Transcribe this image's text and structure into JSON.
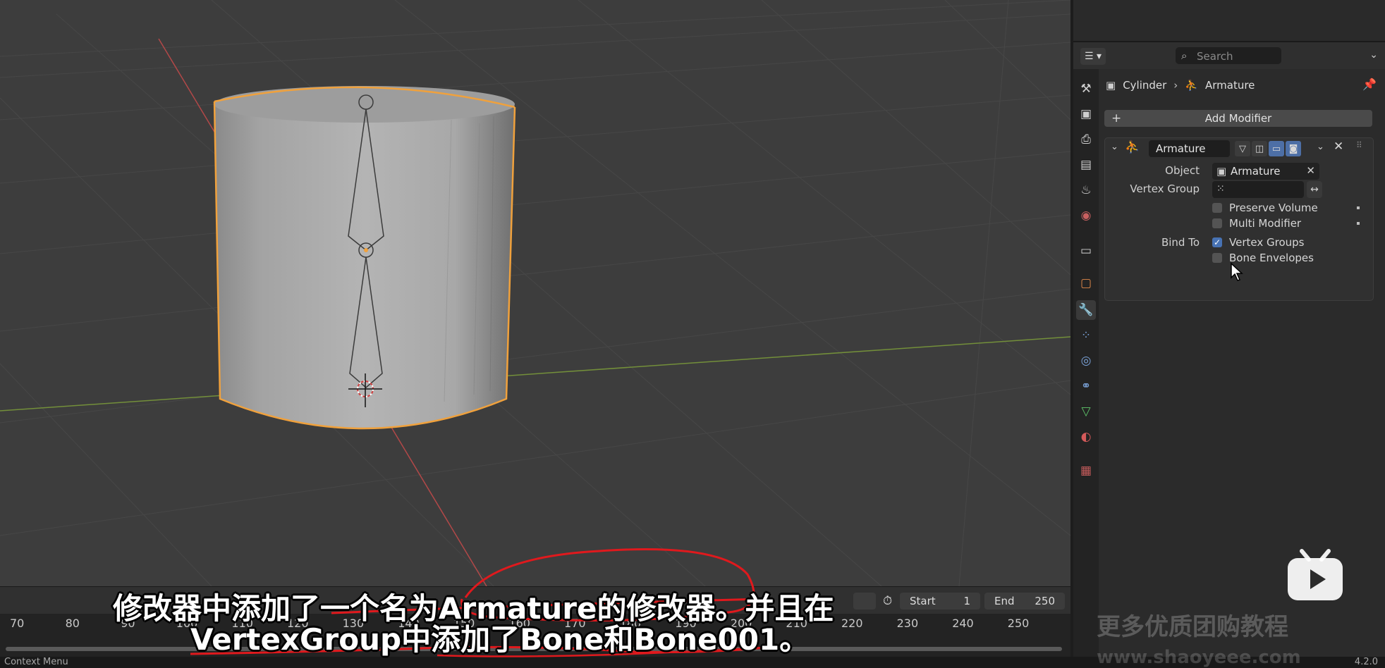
{
  "viewport": {
    "object": "Cylinder"
  },
  "timeline": {
    "start_label": "Start",
    "start_value": "1",
    "end_label": "End",
    "end_value": "250",
    "ticks": [
      "70",
      "80",
      "90",
      "100",
      "110",
      "120",
      "130",
      "140",
      "150",
      "160",
      "170",
      "180",
      "190",
      "200",
      "210",
      "220",
      "230",
      "240",
      "250"
    ]
  },
  "status": {
    "left": "Context Menu",
    "version": "4.2.0"
  },
  "properties": {
    "search_placeholder": "Search",
    "breadcrumb": {
      "object": "Cylinder",
      "modifier": "Armature"
    },
    "add_modifier": "Add Modifier",
    "modifier": {
      "name": "Armature",
      "object_label": "Object",
      "object_value": "Armature",
      "vertex_group_label": "Vertex Group",
      "vertex_group_value": "",
      "preserve_volume": {
        "label": "Preserve Volume",
        "checked": false
      },
      "multi_modifier": {
        "label": "Multi Modifier",
        "checked": false
      },
      "bind_to_label": "Bind To",
      "vertex_groups": {
        "label": "Vertex Groups",
        "checked": true
      },
      "bone_envelopes": {
        "label": "Bone Envelopes",
        "checked": false
      }
    }
  },
  "overlay": {
    "subtitle_line1": "修改器中添加了一个名为Armature的修改器。并且在",
    "subtitle_line2": "VertexGroup中添加了Bone和Bone001。",
    "watermark": "更多优质团购教程",
    "watermark2": "www.shaoyeee.com"
  },
  "colors": {
    "selection_outline": "#f0a13c",
    "x_axis": "#c24a4a",
    "y_axis": "#7a9a3a",
    "active_tab": "#4d8fd8",
    "checkbox_on": "#4772b3"
  }
}
